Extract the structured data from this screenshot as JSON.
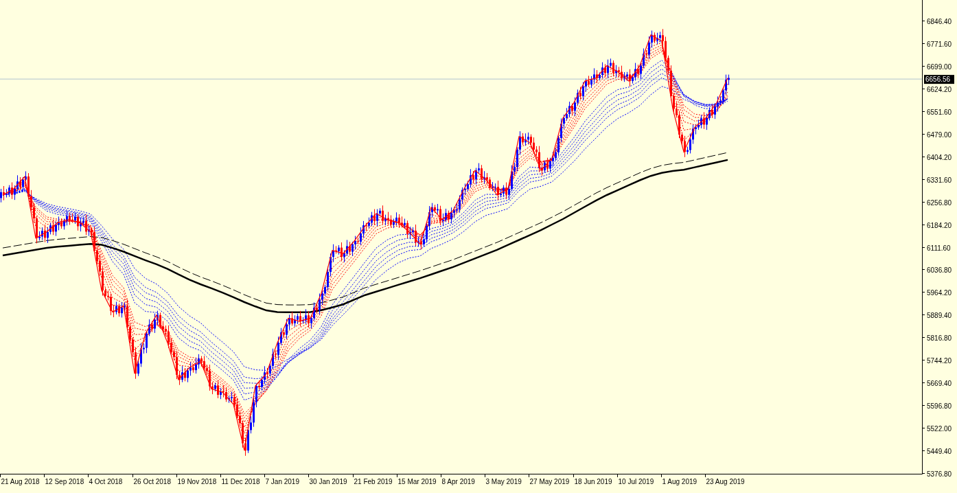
{
  "chart": {
    "current_price": "6656.56",
    "price_axis_labels": [
      "6846.40",
      "6771.60",
      "6699.00",
      "6624.20",
      "6551.60",
      "6479.00",
      "6404.20",
      "6331.60",
      "6256.80",
      "6184.20",
      "6111.60",
      "6036.80",
      "5964.20",
      "5889.40",
      "5816.80",
      "5744.20",
      "5669.40",
      "5596.80",
      "5522.00",
      "5449.40",
      "5376.80"
    ],
    "date_axis_labels": [
      "21 Aug 2018",
      "12 Sep 2018",
      "4 Oct 2018",
      "26 Oct 2018",
      "19 Nov 2018",
      "11 Dec 2018",
      "7 Jan 2019",
      "30 Jan 2019",
      "21 Feb 2019",
      "15 Mar 2019",
      "8 Apr 2019",
      "3 May 2019",
      "27 May 2019",
      "18 Jun 2019",
      "10 Jul 2019",
      "1 Aug 2019",
      "23 Aug 2019"
    ]
  }
}
